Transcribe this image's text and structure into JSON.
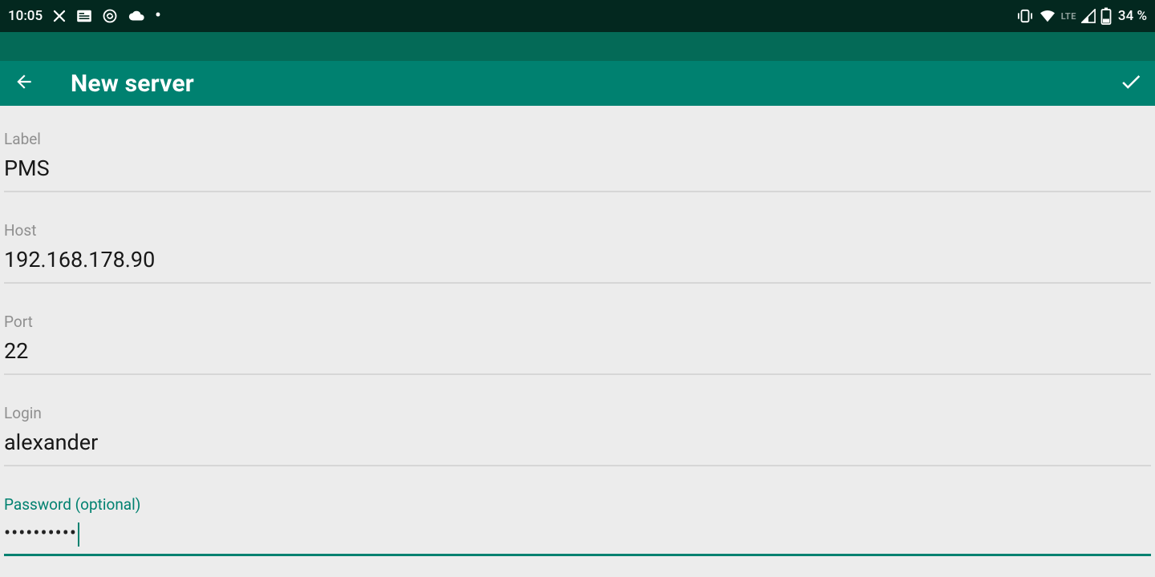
{
  "status": {
    "time": "10:05",
    "lte": "LTE",
    "battery_pct": "34 %"
  },
  "appbar": {
    "title": "New server"
  },
  "fields": {
    "label": {
      "label": "Label",
      "value": "PMS"
    },
    "host": {
      "label": "Host",
      "value": "192.168.178.90"
    },
    "port": {
      "label": "Port",
      "value": "22"
    },
    "login": {
      "label": "Login",
      "value": "alexander"
    },
    "password": {
      "label": "Password (optional)",
      "value": "••••••••••"
    }
  },
  "colors": {
    "statusbar_bg": "#03281f",
    "header_bg": "#046a57",
    "appbar_bg": "#008170",
    "accent": "#008170",
    "page_bg": "#ececec"
  }
}
